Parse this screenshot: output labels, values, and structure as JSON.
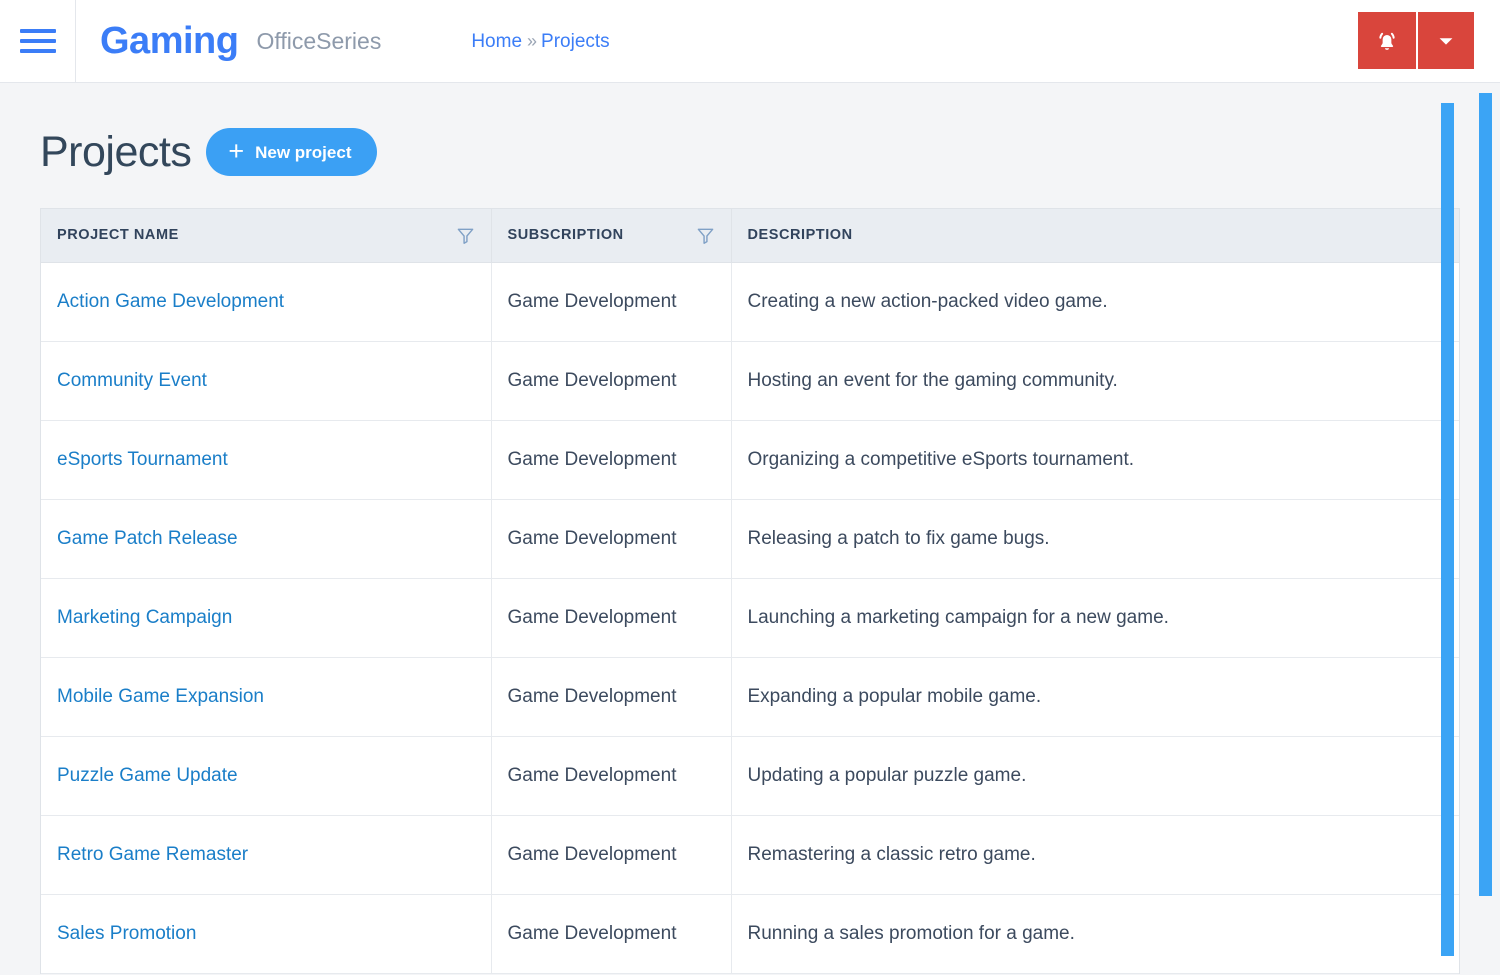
{
  "topbar": {
    "menu_icon": "hamburger-icon",
    "brand": "Gaming",
    "brand_sub": "OfficeSeries",
    "breadcrumb": {
      "home": "Home",
      "separator": "»",
      "current": "Projects"
    },
    "notifications_icon": "bell-icon",
    "dropdown_icon": "chevron-down-icon",
    "action_color": "#d9453c"
  },
  "page": {
    "title": "Projects",
    "new_project_label": "New project",
    "new_project_plus": "+",
    "accent_color": "#3ba0f4"
  },
  "table": {
    "columns": [
      {
        "label": "PROJECT NAME",
        "filter": true
      },
      {
        "label": "SUBSCRIPTION",
        "filter": true
      },
      {
        "label": "DESCRIPTION",
        "filter": false
      }
    ],
    "rows": [
      {
        "name": "Action Game Development",
        "subscription": "Game Development",
        "description": "Creating a new action-packed video game."
      },
      {
        "name": "Community Event",
        "subscription": "Game Development",
        "description": "Hosting an event for the gaming community."
      },
      {
        "name": "eSports Tournament",
        "subscription": "Game Development",
        "description": "Organizing a competitive eSports tournament."
      },
      {
        "name": "Game Patch Release",
        "subscription": "Game Development",
        "description": "Releasing a patch to fix game bugs."
      },
      {
        "name": "Marketing Campaign",
        "subscription": "Game Development",
        "description": "Launching a marketing campaign for a new game."
      },
      {
        "name": "Mobile Game Expansion",
        "subscription": "Game Development",
        "description": "Expanding a popular mobile game."
      },
      {
        "name": "Puzzle Game Update",
        "subscription": "Game Development",
        "description": "Updating a popular puzzle game."
      },
      {
        "name": "Retro Game Remaster",
        "subscription": "Game Development",
        "description": "Remastering a classic retro game."
      },
      {
        "name": "Sales Promotion",
        "subscription": "Game Development",
        "description": "Running a sales promotion for a game."
      }
    ]
  },
  "scrollbars": {
    "color": "#3ba4f5",
    "inner_label": "table-vertical-scrollbar",
    "outer_label": "page-vertical-scrollbar"
  }
}
